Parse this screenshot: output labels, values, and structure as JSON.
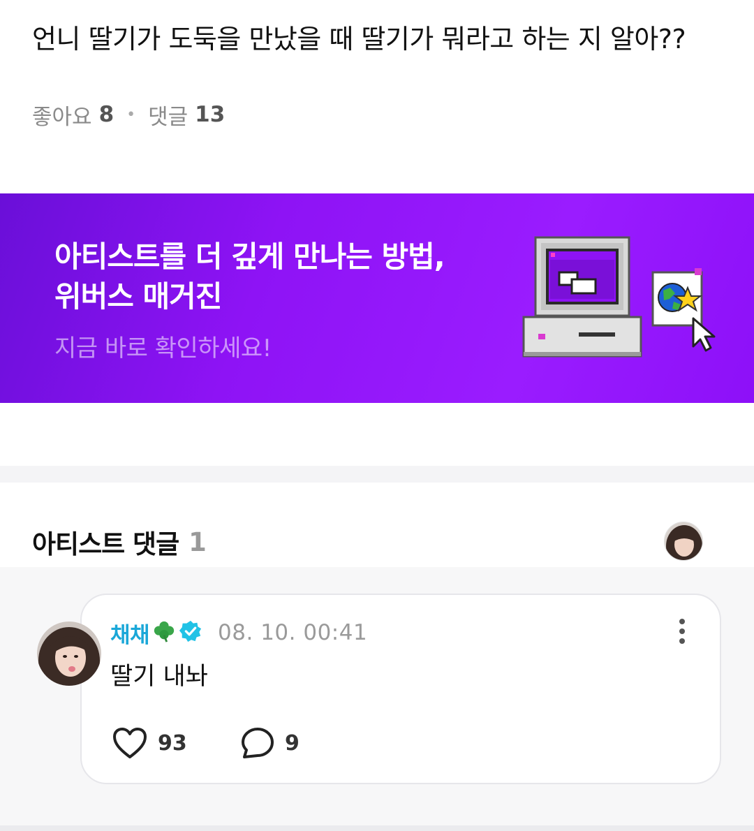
{
  "post": {
    "text": "언니 딸기가 도둑을 만났을 때 딸기가 뭐라고 하는 지 알아??",
    "likes_label": "좋아요",
    "likes_count": "8",
    "comments_label": "댓글",
    "comments_count": "13"
  },
  "banner": {
    "title_line1": "아티스트를 더 깊게 만나는 방법,",
    "title_line2": "위버스 매거진",
    "subtitle": "지금 바로 확인하세요!"
  },
  "artist_comments": {
    "title": "아티스트 댓글",
    "count": "1"
  },
  "comment": {
    "author": "채채",
    "author_emoji": "🍀",
    "timestamp": "08. 10. 00:41",
    "text": "딸기 내놔",
    "likes": "93",
    "replies": "9"
  },
  "colors": {
    "banner_purple": "#8e13f5",
    "author_blue": "#1aa7d8",
    "badge_cyan": "#21c2e6"
  }
}
